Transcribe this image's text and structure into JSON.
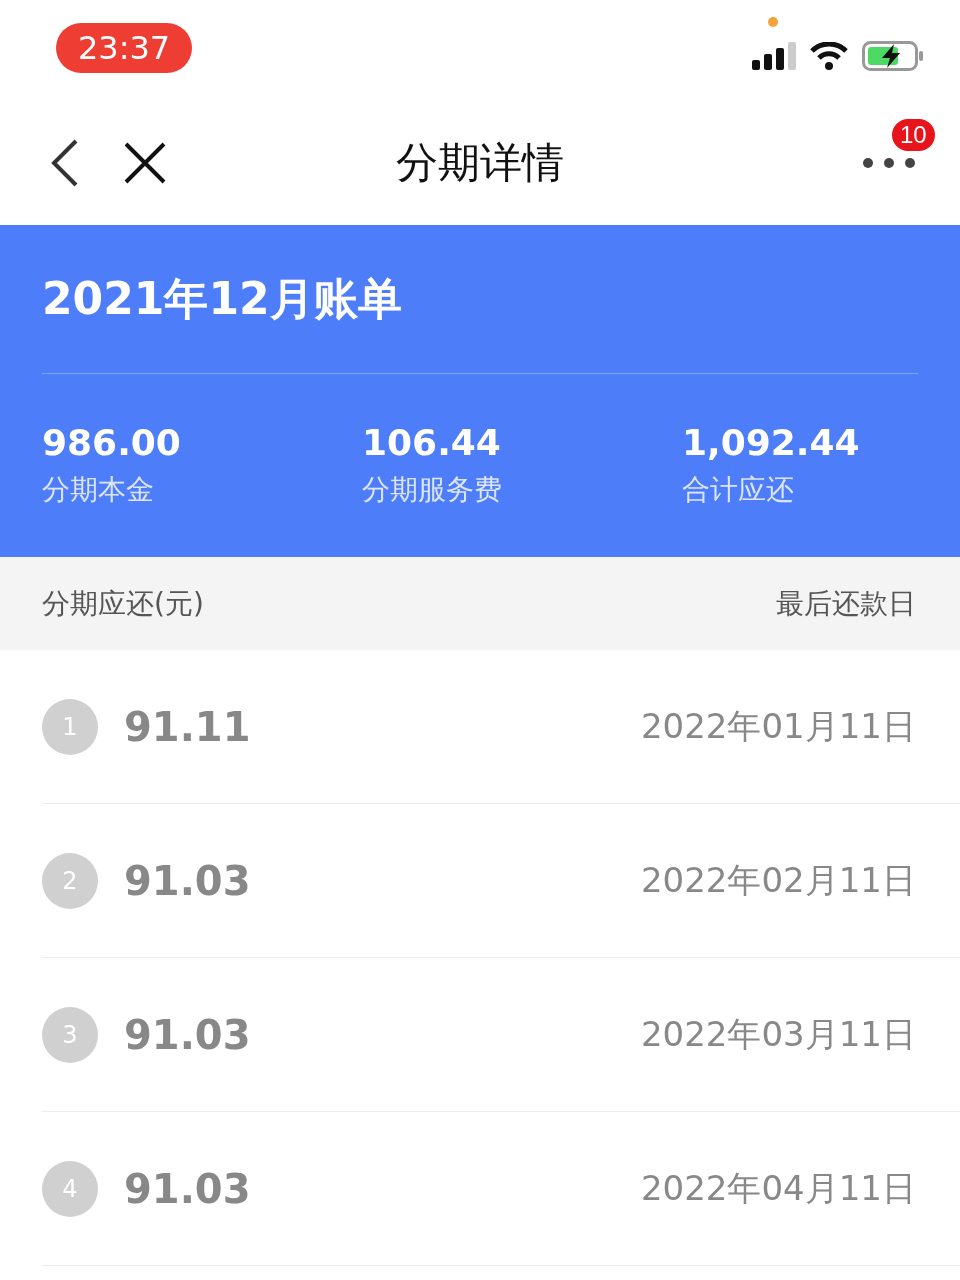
{
  "status_bar": {
    "time": "23:37"
  },
  "nav": {
    "title": "分期详情",
    "badge": "10"
  },
  "summary": {
    "title": "2021年12月账单",
    "stats": [
      {
        "value": "986.00",
        "label": "分期本金"
      },
      {
        "value": "106.44",
        "label": "分期服务费"
      },
      {
        "value": "1,092.44",
        "label": "合计应还"
      }
    ]
  },
  "table": {
    "columns": [
      "分期应还(元)",
      "最后还款日"
    ],
    "rows": [
      {
        "index": "1",
        "amount": "91.11",
        "date": "2022年01月11日"
      },
      {
        "index": "2",
        "amount": "91.03",
        "date": "2022年02月11日"
      },
      {
        "index": "3",
        "amount": "91.03",
        "date": "2022年03月11日"
      },
      {
        "index": "4",
        "amount": "91.03",
        "date": "2022年04月11日"
      }
    ]
  }
}
